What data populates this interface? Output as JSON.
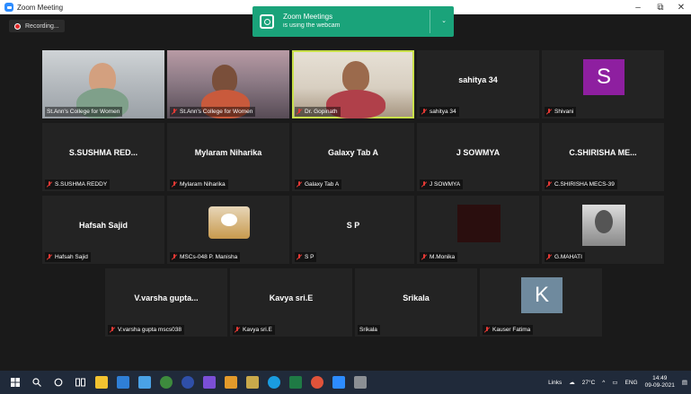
{
  "window": {
    "title": "Zoom Meeting",
    "minimize": "–",
    "restore": "⧉",
    "close": "✕"
  },
  "recording": {
    "label": "Recording..."
  },
  "notification": {
    "title": "Zoom Meetings",
    "subtitle": "is using the webcam",
    "chevron": "⌄"
  },
  "tiles": [
    {
      "name": "",
      "label": "St.Ann's College for Women",
      "muted": false,
      "video": "video1"
    },
    {
      "name": "",
      "label": "St.Ann's College for Women",
      "muted": true,
      "video": "video2"
    },
    {
      "name": "",
      "label": "Dr. Gopinath",
      "muted": true,
      "video": "video3",
      "active": true
    },
    {
      "name": "sahitya 34",
      "label": "sahitya 34",
      "muted": true
    },
    {
      "name": "",
      "label": "Shivani",
      "muted": true,
      "avatar_letter": "S",
      "avatar_color": "#8e1fa0"
    },
    {
      "name": "S.SUSHMA RED...",
      "label": "S.SUSHMA REDDY",
      "muted": true
    },
    {
      "name": "Mylaram Niharika",
      "label": "Mylaram Niharika",
      "muted": true
    },
    {
      "name": "Galaxy Tab A",
      "label": "Galaxy Tab A",
      "muted": true
    },
    {
      "name": "J SOWMYA",
      "label": "J SOWMYA",
      "muted": true
    },
    {
      "name": "C.SHIRISHA ME...",
      "label": "C.SHIRISHA MECS-39",
      "muted": true
    },
    {
      "name": "Hafsah Sajid",
      "label": "Hafsah Sajid",
      "muted": true
    },
    {
      "name": "",
      "label": "MSCs-048 P. Manisha",
      "muted": true,
      "image": "cat"
    },
    {
      "name": "S P",
      "label": "S P",
      "muted": true
    },
    {
      "name": "",
      "label": "M.Monika",
      "muted": true,
      "image": "dark"
    },
    {
      "name": "",
      "label": "G.MAHATI",
      "muted": true,
      "image": "portrait"
    },
    {
      "name": "V.varsha gupta...",
      "label": "V.varsha gupta mscs038",
      "muted": true
    },
    {
      "name": "Kavya sri.E",
      "label": "Kavya sri.E",
      "muted": true
    },
    {
      "name": "Srikala",
      "label": "Srikala",
      "muted": false
    },
    {
      "name": "",
      "label": "Kauser Fatima",
      "muted": true,
      "avatar_letter": "K",
      "avatar_color": "#6f8a9e"
    }
  ],
  "taskbar": {
    "tray": {
      "links": "Links",
      "weather": "27°C",
      "lang": "ENG",
      "time": "14:49",
      "date": "09-09-2021"
    }
  }
}
